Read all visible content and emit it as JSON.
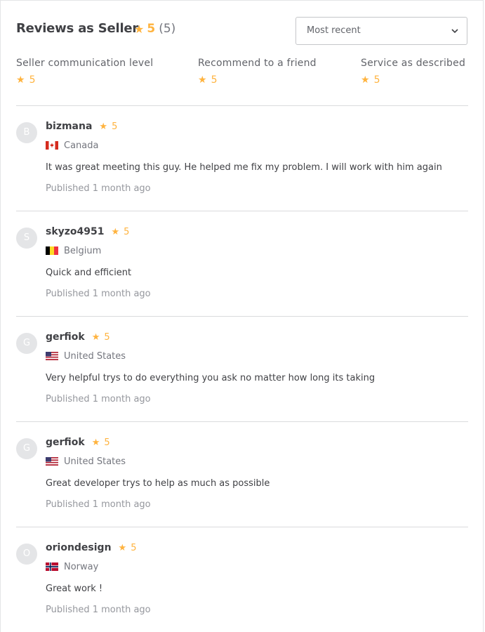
{
  "header": {
    "title": "Reviews as Seller",
    "rating": "5",
    "count": "(5)",
    "sort": {
      "selected": "Most recent"
    }
  },
  "breakdown": [
    {
      "label": "Seller communication level",
      "rating": "5"
    },
    {
      "label": "Recommend to a friend",
      "rating": "5"
    },
    {
      "label": "Service as described",
      "rating": "5"
    }
  ],
  "reviews": [
    {
      "initial": "B",
      "username": "bizmana",
      "rating": "5",
      "country": "Canada",
      "flag": "canada-flag",
      "text": "It was great meeting this guy. He helped me fix my problem. I will work with him again",
      "date": "Published 1 month ago"
    },
    {
      "initial": "S",
      "username": "skyzo4951",
      "rating": "5",
      "country": "Belgium",
      "flag": "belgium-flag",
      "text": "Quick and efficient",
      "date": "Published 1 month ago"
    },
    {
      "initial": "G",
      "username": "gerfiok",
      "rating": "5",
      "country": "United States",
      "flag": "us-flag",
      "text": "Very helpful trys to do everything you ask no matter how long its taking",
      "date": "Published 1 month ago"
    },
    {
      "initial": "G",
      "username": "gerfiok",
      "rating": "5",
      "country": "United States",
      "flag": "us-flag",
      "text": "Great developer trys to help as much as possible",
      "date": "Published 1 month ago"
    },
    {
      "initial": "O",
      "username": "oriondesign",
      "rating": "5",
      "country": "Norway",
      "flag": "norway-flag",
      "text": "Great work !",
      "date": "Published 1 month ago"
    }
  ],
  "colors": {
    "star": "#ffb33e",
    "divider": "#dadbdd",
    "text": "#404145",
    "muted": "#74767e"
  },
  "icons": {
    "star": "star-icon",
    "sort": "chevron-down-icon"
  }
}
